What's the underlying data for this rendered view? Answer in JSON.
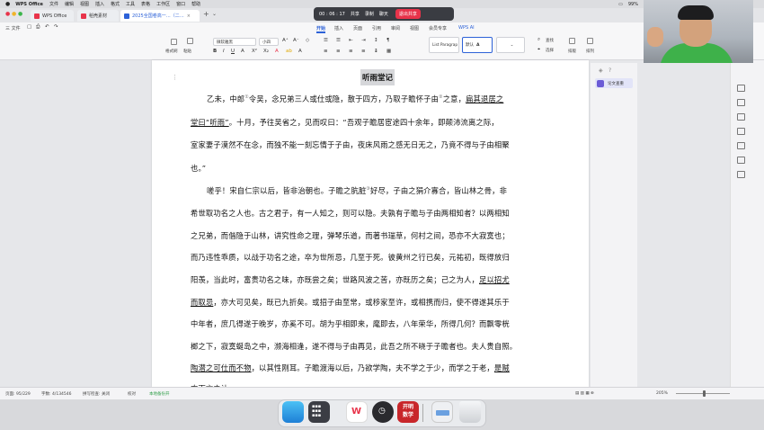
{
  "menubar": {
    "app_name": "WPS Office",
    "items": [
      "文件",
      "编辑",
      "视图",
      "插入",
      "格式",
      "工具",
      "表格",
      "工作区",
      "窗口",
      "帮助"
    ],
    "right_text": "99%"
  },
  "tabs": [
    {
      "label": "WPS Office"
    },
    {
      "label": "稻壳素材"
    },
    {
      "label": "2025全国卷高一…（二…"
    }
  ],
  "meeting": {
    "timer": "00 : 06 : 17",
    "share": "共享",
    "record": "录制",
    "chat": "聊天",
    "end": "退出共享"
  },
  "toolbar": {
    "file_menu": "三 文件",
    "ribbon_tabs": [
      "开始",
      "插入",
      "页面",
      "引用",
      "审阅",
      "视图",
      "会员专享",
      "WPS AI"
    ],
    "active_tab": "开始",
    "format_painter": "格式刷",
    "paste": "粘贴",
    "font_name": "微软雅黑",
    "font_size": "小四",
    "style_preview": "List Paragrap",
    "style_normal": "默认",
    "find": "查找",
    "select": "选择",
    "row_col": "排版",
    "layout": "排列"
  },
  "document": {
    "title": "听雨堂记",
    "line1_a": "乙未，中郎",
    "line1_sup": "①",
    "line1_b": "令吴，念兄弟三人或仕或隐，散于四方，乃取子瞻怀子由",
    "line1_sup2": "②",
    "line1_c": "之意，",
    "line1_u": "扁其退居之",
    "line2_u": "堂曰“听雨”",
    "line2_b": "。十月，予往吴省之，见而叹曰：“吾观子瞻居宦途四十余年，即颠沛流离之际，",
    "line3": "室家妻子漠然不在念，而独不能一刻忘情于子由，夜床风雨之感无日无之，乃竟不得与子由相聚",
    "line4": "也。”",
    "line5_a": "嗟乎！宋自仁宗以后，皆非治朝也。子瞻之肮脏",
    "line5_sup": "③",
    "line5_b": "好尽，子由之狷介寡合，皆山林之骨，非",
    "line6": "希世取功名之人也。古之君子，有一人知之，则可以隐。夫孰有子瞻与子由两相知者？以两相知",
    "line7": "之兄弟，而偕隐于山林，讲究性命之理，弹琴乐道，而著书瑞草，何村之间，恐亦不大寂寞也；",
    "line8": "而乃违性乖质，以战于功名之途，卒为世所忌，几至于死。彼黄州之行已矣，元祐初，既得放归",
    "line9_a": "阳羡，当此时，富贵功名之味，亦既尝之矣；世路风波之苦，亦既历之矣；己之为人，",
    "line9_u": "足以招尤",
    "line10_u": "而取忌",
    "line10_b": "，亦大可见矣，既已九折矣。或招子由至常，或移家至许，或相携而归，使不得遂其乐于",
    "line11": "中年者，庶几得遂于晚岁，亦奚不可。胡为乎相即来，麾即去，八年荣华，所得几何？而飘零桄",
    "line12": "榔之下，寂寞蜒岛之中，濒海相逢，遂不得与子由再见，此吾之所不晓于子瞻者也。夫人贵自照。",
    "line13_u": "陶潜之可仕而不物",
    "line13_b": "，以其性刚耳。子瞻渡海以后，乃欲学陶，夫不学之于少，而学之于老，",
    "line13_u2": "是贼",
    "line14": "肉而言之让"
  },
  "side_panel": {
    "button": "论文查重"
  },
  "statusbar": {
    "page": "页面: 95/229",
    "words": "字数: 4/134546",
    "spell": "拼写检查: 关闭",
    "proof": "校对",
    "backup": "本地备份开",
    "zoom": "205%"
  },
  "dock": {
    "icon1_text": "开明",
    "icon2_text": "数学"
  },
  "colors": {
    "accent": "#2d62d8",
    "end_button": "#e8334a",
    "shirt": "#3eb14a"
  }
}
